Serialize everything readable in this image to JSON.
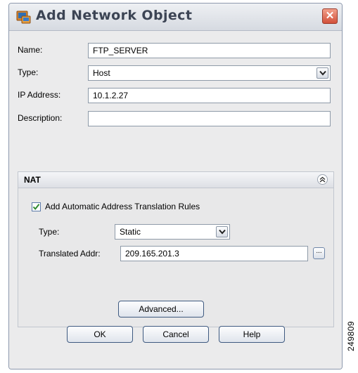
{
  "window": {
    "title": "Add Network Object",
    "close_glyph": "✕",
    "icon": "network-object-icon"
  },
  "form": {
    "name_label": "Name:",
    "name_value": "FTP_SERVER",
    "type_label": "Type:",
    "type_value": "Host",
    "ip_label": "IP Address:",
    "ip_value": "10.1.2.27",
    "description_label": "Description:",
    "description_value": ""
  },
  "nat": {
    "title": "NAT",
    "checkbox_label": "Add Automatic Address Translation Rules",
    "checkbox_checked": true,
    "type_label": "Type:",
    "type_value": "Static",
    "translated_label": "Translated Addr:",
    "translated_value": "209.165.201.3",
    "browse_label": "...",
    "advanced_label": "Advanced..."
  },
  "buttons": {
    "ok": "OK",
    "cancel": "Cancel",
    "help": "Help"
  },
  "figure_id": "249809",
  "colors": {
    "accent_border": "#3f5a80",
    "close": "#d2503a",
    "check": "#2f8a2f"
  }
}
